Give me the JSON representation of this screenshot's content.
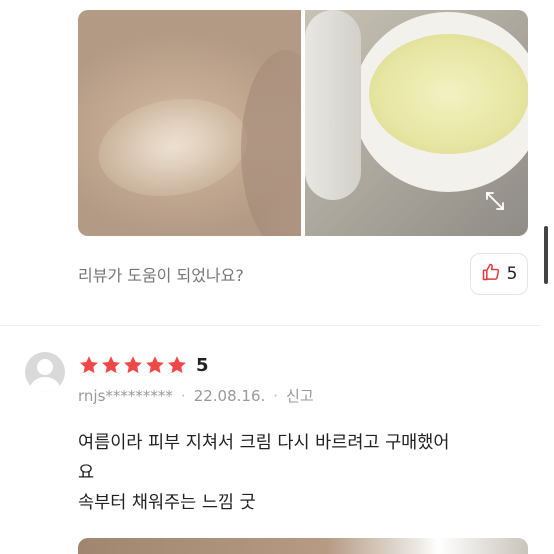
{
  "review_prev": {
    "helpful_question": "리뷰가 도움이 되었나요?",
    "like_count": "5",
    "photos": [
      {
        "icon": "skin-swatch-photo"
      },
      {
        "icon": "cream-jar-photo"
      }
    ]
  },
  "review": {
    "rating": "5",
    "stars": 5,
    "username": "rnjs*********",
    "date": "22.08.16.",
    "report_label": "신고",
    "body_lines": [
      "여름이라 피부 지쳐서 크림 다시 바르려고 구매했어",
      "요",
      "속부터 채워주는 느낌 굿"
    ]
  },
  "colors": {
    "star": "#f04747",
    "like_icon": "#e03a3a"
  }
}
